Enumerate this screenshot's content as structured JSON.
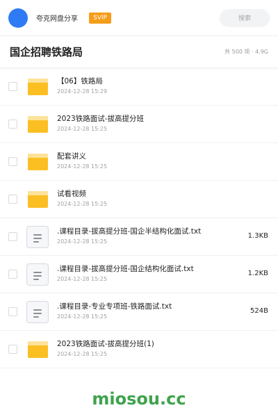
{
  "header": {
    "user_name": "夸克网盘分享",
    "vip_badge": "SVIP",
    "search_placeholder": "搜索"
  },
  "title_row": {
    "title": "国企招聘铁路局",
    "meta": "共 500 项 · 4.9G"
  },
  "files": [
    {
      "name": "【06】铁路局",
      "date": "2024-12-28 15:29",
      "type": "folder",
      "size": ""
    },
    {
      "name": "2023铁路面试-拔高提分班",
      "date": "2024-12-28 15:25",
      "type": "folder",
      "size": ""
    },
    {
      "name": "配套讲义",
      "date": "2024-12-28 15:25",
      "type": "folder",
      "size": ""
    },
    {
      "name": "试看视频",
      "date": "2024-12-28 15:25",
      "type": "folder",
      "size": ""
    },
    {
      "name": ".课程目录-拔高提分班-国企半结构化面试.txt",
      "date": "2024-12-28 15:25",
      "type": "txt",
      "size": "1.3KB"
    },
    {
      "name": ".课程目录-拔高提分班-国企结构化面试.txt",
      "date": "2024-12-28 15:25",
      "type": "txt",
      "size": "1.2KB"
    },
    {
      "name": ".课程目录-专业专项班-铁路面试.txt",
      "date": "2024-12-28 15:25",
      "type": "txt",
      "size": "524B"
    },
    {
      "name": "2023铁路面试-拔高提分班(1)",
      "date": "2024-12-28 15:25",
      "type": "folder",
      "size": ""
    }
  ],
  "watermark": "miosou.cc",
  "colors": {
    "avatar": "#2f7bf5",
    "vip": "#f59c1a",
    "folder": "#fbbf24",
    "watermark": "#3fa34d"
  }
}
